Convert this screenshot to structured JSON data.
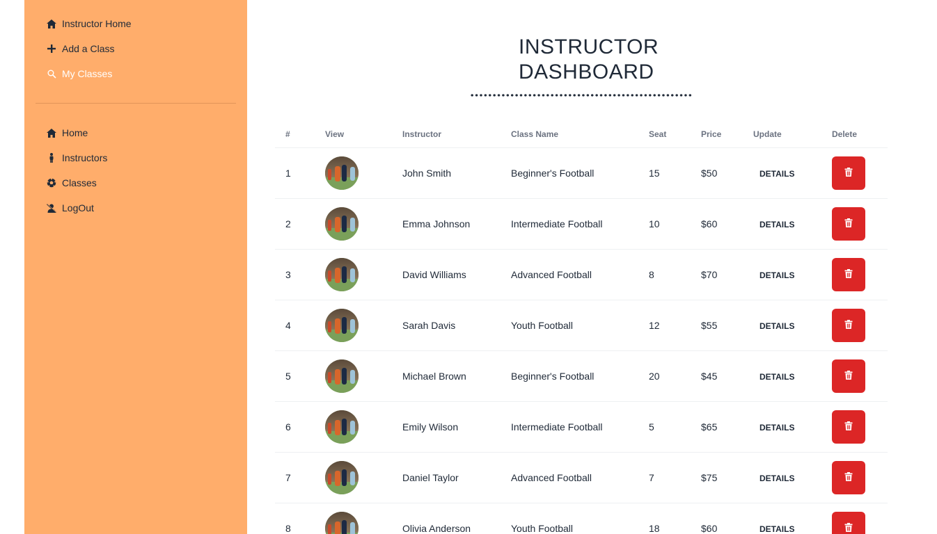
{
  "sidebar": {
    "top_items": [
      {
        "label": "Instructor Home",
        "icon": "home-icon"
      },
      {
        "label": "Add a Class",
        "icon": "plus-icon"
      },
      {
        "label": "My Classes",
        "icon": "search-icon",
        "active": true
      }
    ],
    "bottom_items": [
      {
        "label": "Home",
        "icon": "home-icon"
      },
      {
        "label": "Instructors",
        "icon": "person-icon"
      },
      {
        "label": "Classes",
        "icon": "soccer-ball-icon"
      },
      {
        "label": "LogOut",
        "icon": "user-slash-icon"
      }
    ]
  },
  "main": {
    "title": "INSTRUCTOR DASHBOARD",
    "table": {
      "headers": [
        "#",
        "View",
        "Instructor",
        "Class Name",
        "Seat",
        "Price",
        "Update",
        "Delete"
      ],
      "details_label": "DETAILS",
      "rows": [
        {
          "num": "1",
          "instructor": "John Smith",
          "class_name": "Beginner's Football",
          "seat": "15",
          "price": "$50"
        },
        {
          "num": "2",
          "instructor": "Emma Johnson",
          "class_name": "Intermediate Football",
          "seat": "10",
          "price": "$60"
        },
        {
          "num": "3",
          "instructor": "David Williams",
          "class_name": "Advanced Football",
          "seat": "8",
          "price": "$70"
        },
        {
          "num": "4",
          "instructor": "Sarah Davis",
          "class_name": "Youth Football",
          "seat": "12",
          "price": "$55"
        },
        {
          "num": "5",
          "instructor": "Michael Brown",
          "class_name": "Beginner's Football",
          "seat": "20",
          "price": "$45"
        },
        {
          "num": "6",
          "instructor": "Emily Wilson",
          "class_name": "Intermediate Football",
          "seat": "5",
          "price": "$65"
        },
        {
          "num": "7",
          "instructor": "Daniel Taylor",
          "class_name": "Advanced Football",
          "seat": "7",
          "price": "$75"
        },
        {
          "num": "8",
          "instructor": "Olivia Anderson",
          "class_name": "Youth Football",
          "seat": "18",
          "price": "$60"
        }
      ]
    }
  },
  "colors": {
    "sidebar_bg": "#FFAD6B",
    "delete_button": "#DC2626",
    "active_nav": "#FFFFFF"
  }
}
